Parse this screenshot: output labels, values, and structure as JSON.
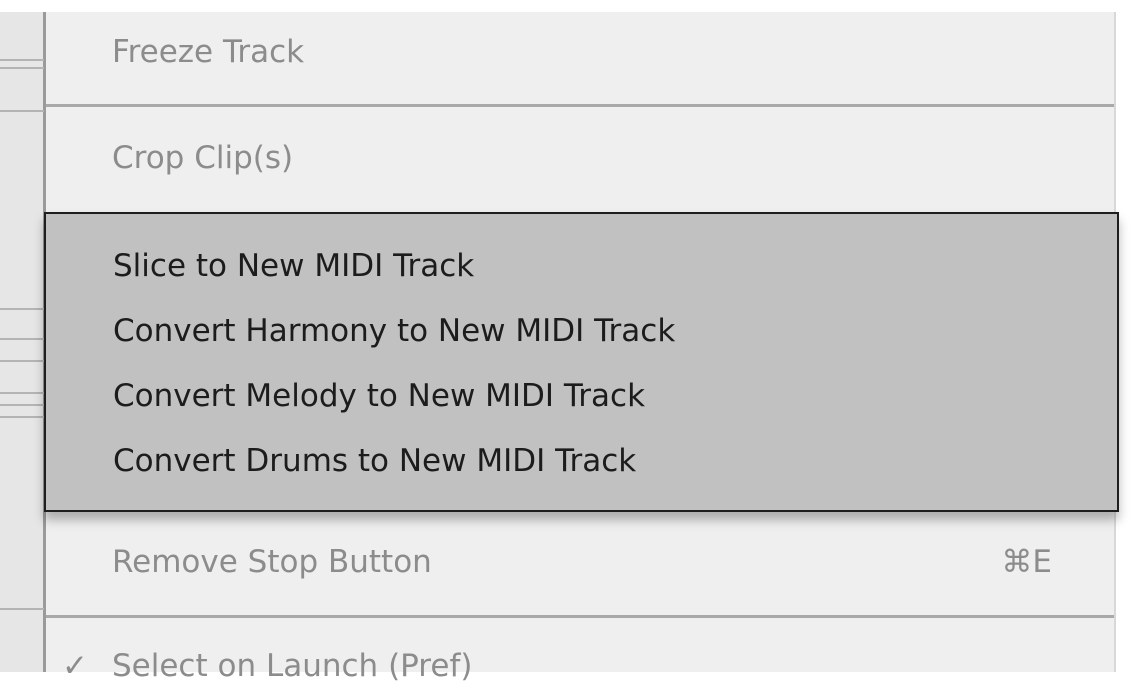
{
  "menu": {
    "items_top": [
      {
        "label": "Freeze Track"
      },
      {
        "label": "Crop Clip(s)"
      }
    ],
    "items_bottom": [
      {
        "label": "Remove Stop Button",
        "shortcut": "⌘E"
      },
      {
        "label": "Select on Launch (Pref)",
        "check": "✓"
      }
    ]
  },
  "submenu": {
    "items": [
      {
        "label": "Slice to New MIDI Track"
      },
      {
        "label": "Convert Harmony to New MIDI Track"
      },
      {
        "label": "Convert Melody to New MIDI Track"
      },
      {
        "label": "Convert Drums to New MIDI Track"
      }
    ]
  },
  "colors": {
    "menu_background": "#efefef",
    "submenu_background": "#c1c1c1",
    "disabled_text": "#8c8c8c",
    "active_text": "#1c1c1c",
    "submenu_border": "#1e1e1e"
  }
}
